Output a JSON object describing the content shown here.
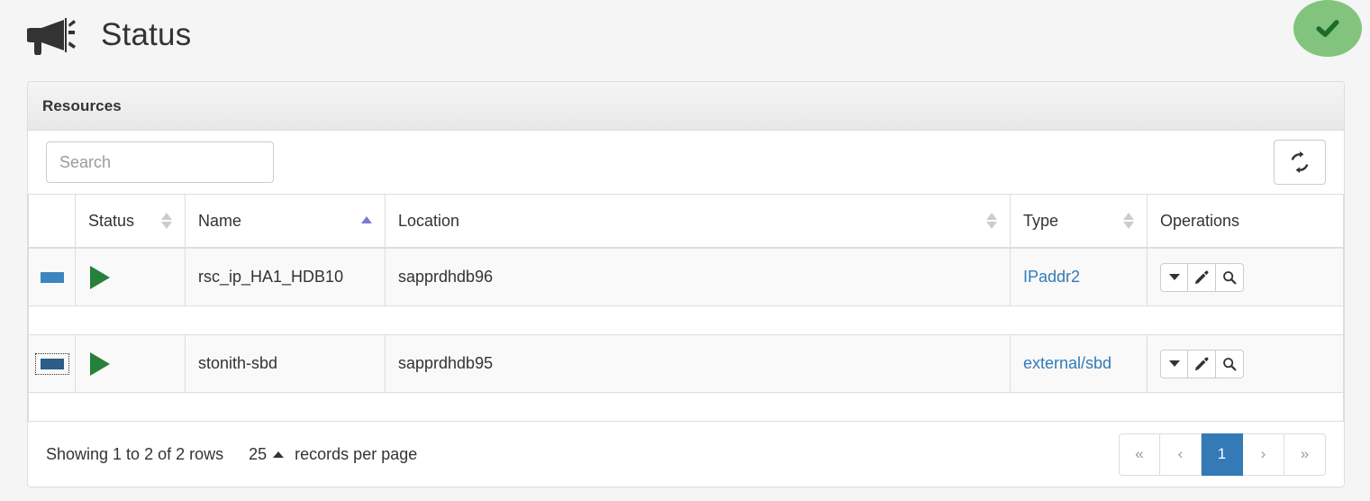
{
  "header": {
    "icon": "bullhorn-icon",
    "title": "Status",
    "status_badge": {
      "icon": "check-icon",
      "color": "#82c47d",
      "check_color": "#1d6b2b"
    }
  },
  "panel": {
    "title": "Resources",
    "toolbar": {
      "search_placeholder": "Search",
      "search_value": "",
      "refresh_icon": "refresh-icon"
    },
    "table": {
      "columns": [
        {
          "key": "expand",
          "label": "",
          "sortable": false
        },
        {
          "key": "status",
          "label": "Status",
          "sortable": true,
          "sort": "none"
        },
        {
          "key": "name",
          "label": "Name",
          "sortable": true,
          "sort": "asc"
        },
        {
          "key": "location",
          "label": "Location",
          "sortable": true,
          "sort": "none"
        },
        {
          "key": "type",
          "label": "Type",
          "sortable": true,
          "sort": "none"
        },
        {
          "key": "operations",
          "label": "Operations",
          "sortable": false
        }
      ],
      "rows": [
        {
          "expand_icon": "minus-icon",
          "expand_focused": false,
          "status_icon": "play-icon",
          "name": "rsc_ip_HA1_HDB10",
          "location": "sapprdhdb96",
          "type": "IPaddr2",
          "operations": [
            "caret-down-icon",
            "pencil-icon",
            "search-icon"
          ]
        },
        {
          "expand_icon": "minus-icon",
          "expand_focused": true,
          "status_icon": "play-icon",
          "name": "stonith-sbd",
          "location": "sapprdhdb95",
          "type": "external/sbd",
          "operations": [
            "caret-down-icon",
            "pencil-icon",
            "search-icon"
          ]
        }
      ]
    },
    "footer": {
      "showing_text": "Showing 1 to 2 of 2 rows",
      "page_size": "25",
      "records_per_page_label": "records per page",
      "pagination": {
        "first": "«",
        "prev": "‹",
        "pages": [
          "1"
        ],
        "current": "1",
        "next": "›",
        "last": "»"
      }
    }
  },
  "colors": {
    "accent_blue": "#337ab7",
    "link_blue": "#337ab7",
    "success_green": "#82c47d",
    "play_green": "#27803a",
    "sort_active": "#7b7bd1"
  }
}
